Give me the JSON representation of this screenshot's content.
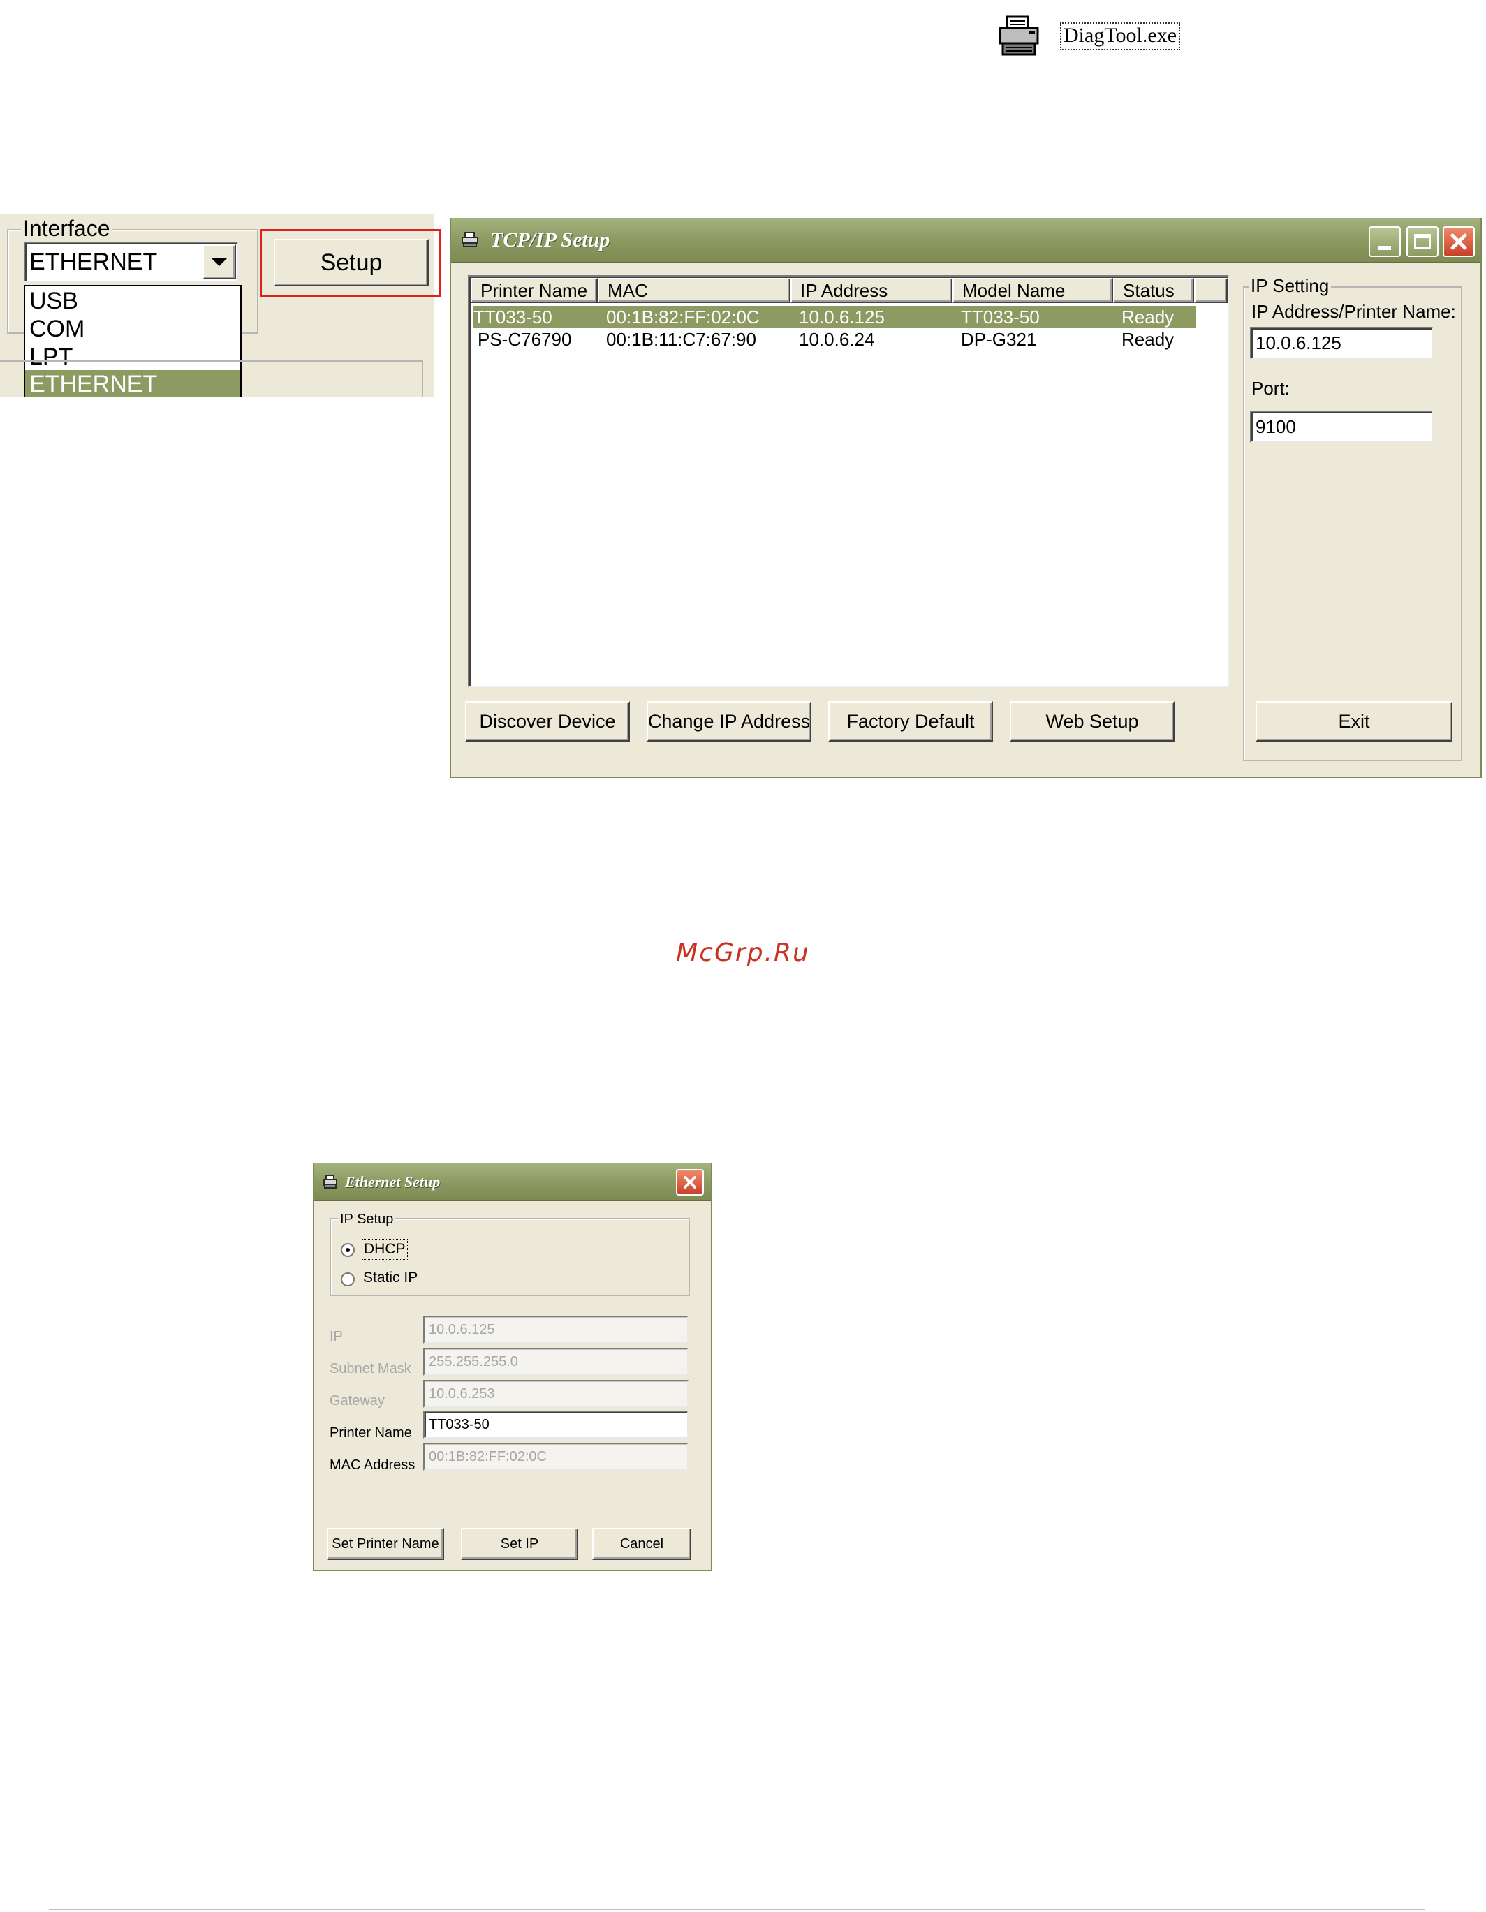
{
  "diagtool": {
    "filename": "DiagTool.exe",
    "icon": "printer-icon"
  },
  "interface_panel": {
    "group_label": "Interface",
    "selected": "ETHERNET",
    "options": [
      "USB",
      "COM",
      "LPT",
      "ETHERNET"
    ],
    "setup_label": "Setup",
    "highlight_color": "#e02020"
  },
  "tcpip": {
    "title": "TCP/IP Setup",
    "columns": [
      "Printer Name",
      "MAC",
      "IP Address",
      "Model Name",
      "Status"
    ],
    "rows": [
      [
        "TT033-50",
        "00:1B:82:FF:02:0C",
        "10.0.6.125",
        "TT033-50",
        "Ready"
      ],
      [
        "PS-C76790",
        "00:1B:11:C7:67:90",
        "10.0.6.24",
        "DP-G321",
        "Ready"
      ]
    ],
    "selected_row": 0,
    "ip_setting": {
      "group_label": "IP Setting",
      "ip_label": "IP Address/Printer Name:",
      "ip_value": "10.0.6.125",
      "port_label": "Port:",
      "port_value": "9100"
    },
    "buttons": {
      "discover": "Discover Device",
      "change_ip": "Change IP Address",
      "factory": "Factory Default",
      "web": "Web Setup",
      "exit": "Exit"
    },
    "accent": "#8d9a62"
  },
  "watermark": "McGrp.Ru",
  "ethernet": {
    "title": "Ethernet Setup",
    "ip_setup_label": "IP Setup",
    "dhcp_label": "DHCP",
    "static_label": "Static IP",
    "mode": "DHCP",
    "fields": {
      "ip_label": "IP",
      "ip_value": "10.0.6.125",
      "mask_label": "Subnet Mask",
      "mask_value": "255.255.255.0",
      "gateway_label": "Gateway",
      "gateway_value": "10.0.6.253",
      "name_label": "Printer Name",
      "name_value": "TT033-50",
      "mac_label": "MAC Address",
      "mac_value": "00:1B:82:FF:02:0C"
    },
    "buttons": {
      "set_name": "Set Printer Name",
      "set_ip": "Set IP",
      "cancel": "Cancel"
    }
  }
}
